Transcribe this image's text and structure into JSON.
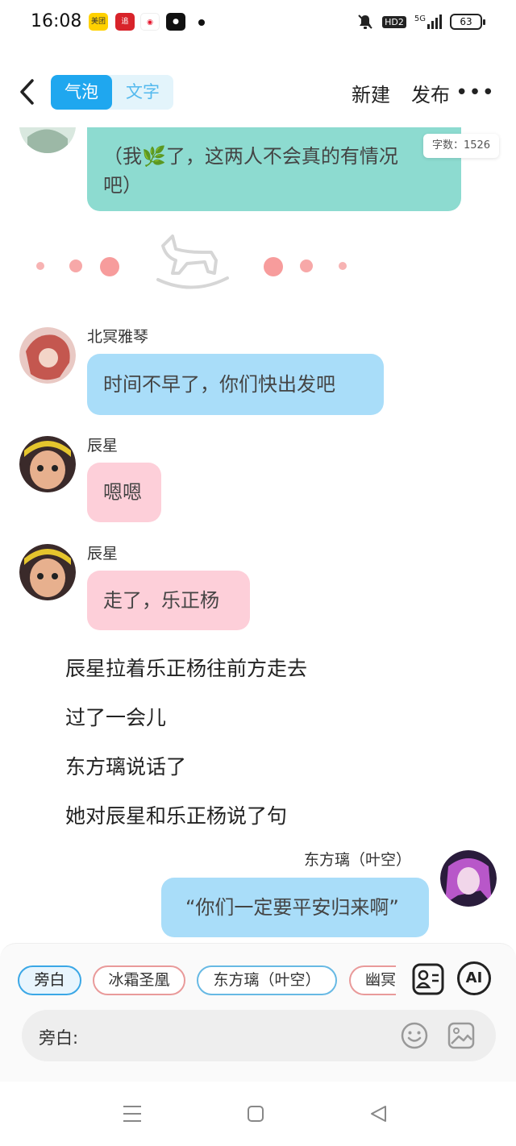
{
  "status_bar": {
    "time": "16:08",
    "apps": [
      "美团",
      "追",
      "微博",
      "录"
    ],
    "network": "5G",
    "hd": "HD2",
    "battery": "63"
  },
  "header": {
    "tab_bubble": "气泡",
    "tab_text": "文字",
    "new_label": "新建",
    "publish_label": "发布",
    "more_label": "•••"
  },
  "chat": {
    "word_count": "字数：1526",
    "messages": [
      {
        "text_line1": "（我🌿了，这两人不会真的有情况",
        "text_line2": "吧）"
      },
      {
        "name": "北冥雅琴",
        "text": "时间不早了，你们快出发吧"
      },
      {
        "name": "辰星",
        "text": "嗯嗯"
      },
      {
        "name": "辰星",
        "text": "走了，乐正杨"
      },
      {
        "name": "东方璃（叶空）",
        "text": "“你们一定要平安归来啊”"
      }
    ],
    "narration": [
      "辰星拉着乐正杨往前方走去",
      "过了一会儿",
      "东方璃说话了",
      "她对辰星和乐正杨说了句"
    ]
  },
  "composer": {
    "chips": [
      "旁白",
      "冰霜圣凰",
      "东方璃（叶空）",
      "幽冥"
    ],
    "input_label": "旁白:",
    "ai_label": "AI"
  },
  "colors": {
    "accent": "#1fa7ef",
    "teal_bubble": "#8ddbd0",
    "blue_bubble": "#a9ddf9",
    "pink_bubble": "#fdcfd9"
  }
}
